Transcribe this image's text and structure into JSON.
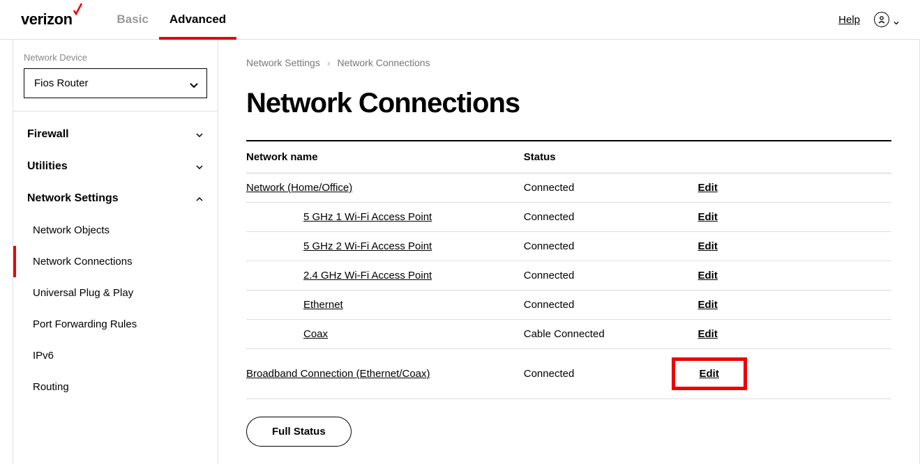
{
  "header": {
    "logo_text": "verizon",
    "tabs": {
      "basic": "Basic",
      "advanced": "Advanced"
    },
    "help_label": "Help"
  },
  "sidebar": {
    "device_label": "Network Device",
    "device_selected": "Fios Router",
    "groups": {
      "firewall": "Firewall",
      "utilities": "Utilities",
      "network_settings": "Network Settings"
    },
    "items": {
      "network_objects": "Network Objects",
      "network_connections": "Network Connections",
      "upnp": "Universal Plug & Play",
      "port_forwarding": "Port Forwarding Rules",
      "ipv6": "IPv6",
      "routing": "Routing"
    }
  },
  "breadcrumb": {
    "parent": "Network Settings",
    "current": "Network Connections"
  },
  "page_title": "Network Connections",
  "table": {
    "headers": {
      "name": "Network name",
      "status": "Status"
    },
    "rows": [
      {
        "name": "Network (Home/Office)",
        "status": "Connected",
        "action": "Edit",
        "indent": false
      },
      {
        "name": "5 GHz 1 Wi-Fi Access Point",
        "status": "Connected",
        "action": "Edit",
        "indent": true
      },
      {
        "name": "5 GHz 2 Wi-Fi Access Point",
        "status": "Connected",
        "action": "Edit",
        "indent": true
      },
      {
        "name": "2.4 GHz Wi-Fi Access Point",
        "status": "Connected",
        "action": "Edit",
        "indent": true
      },
      {
        "name": "Ethernet",
        "status": "Connected",
        "action": "Edit",
        "indent": true
      },
      {
        "name": "Coax",
        "status": "Cable Connected",
        "action": "Edit",
        "indent": true
      },
      {
        "name": "Broadband Connection (Ethernet/Coax)",
        "status": "Connected",
        "action": "Edit",
        "indent": false,
        "highlight": true
      }
    ]
  },
  "full_status_label": "Full Status"
}
